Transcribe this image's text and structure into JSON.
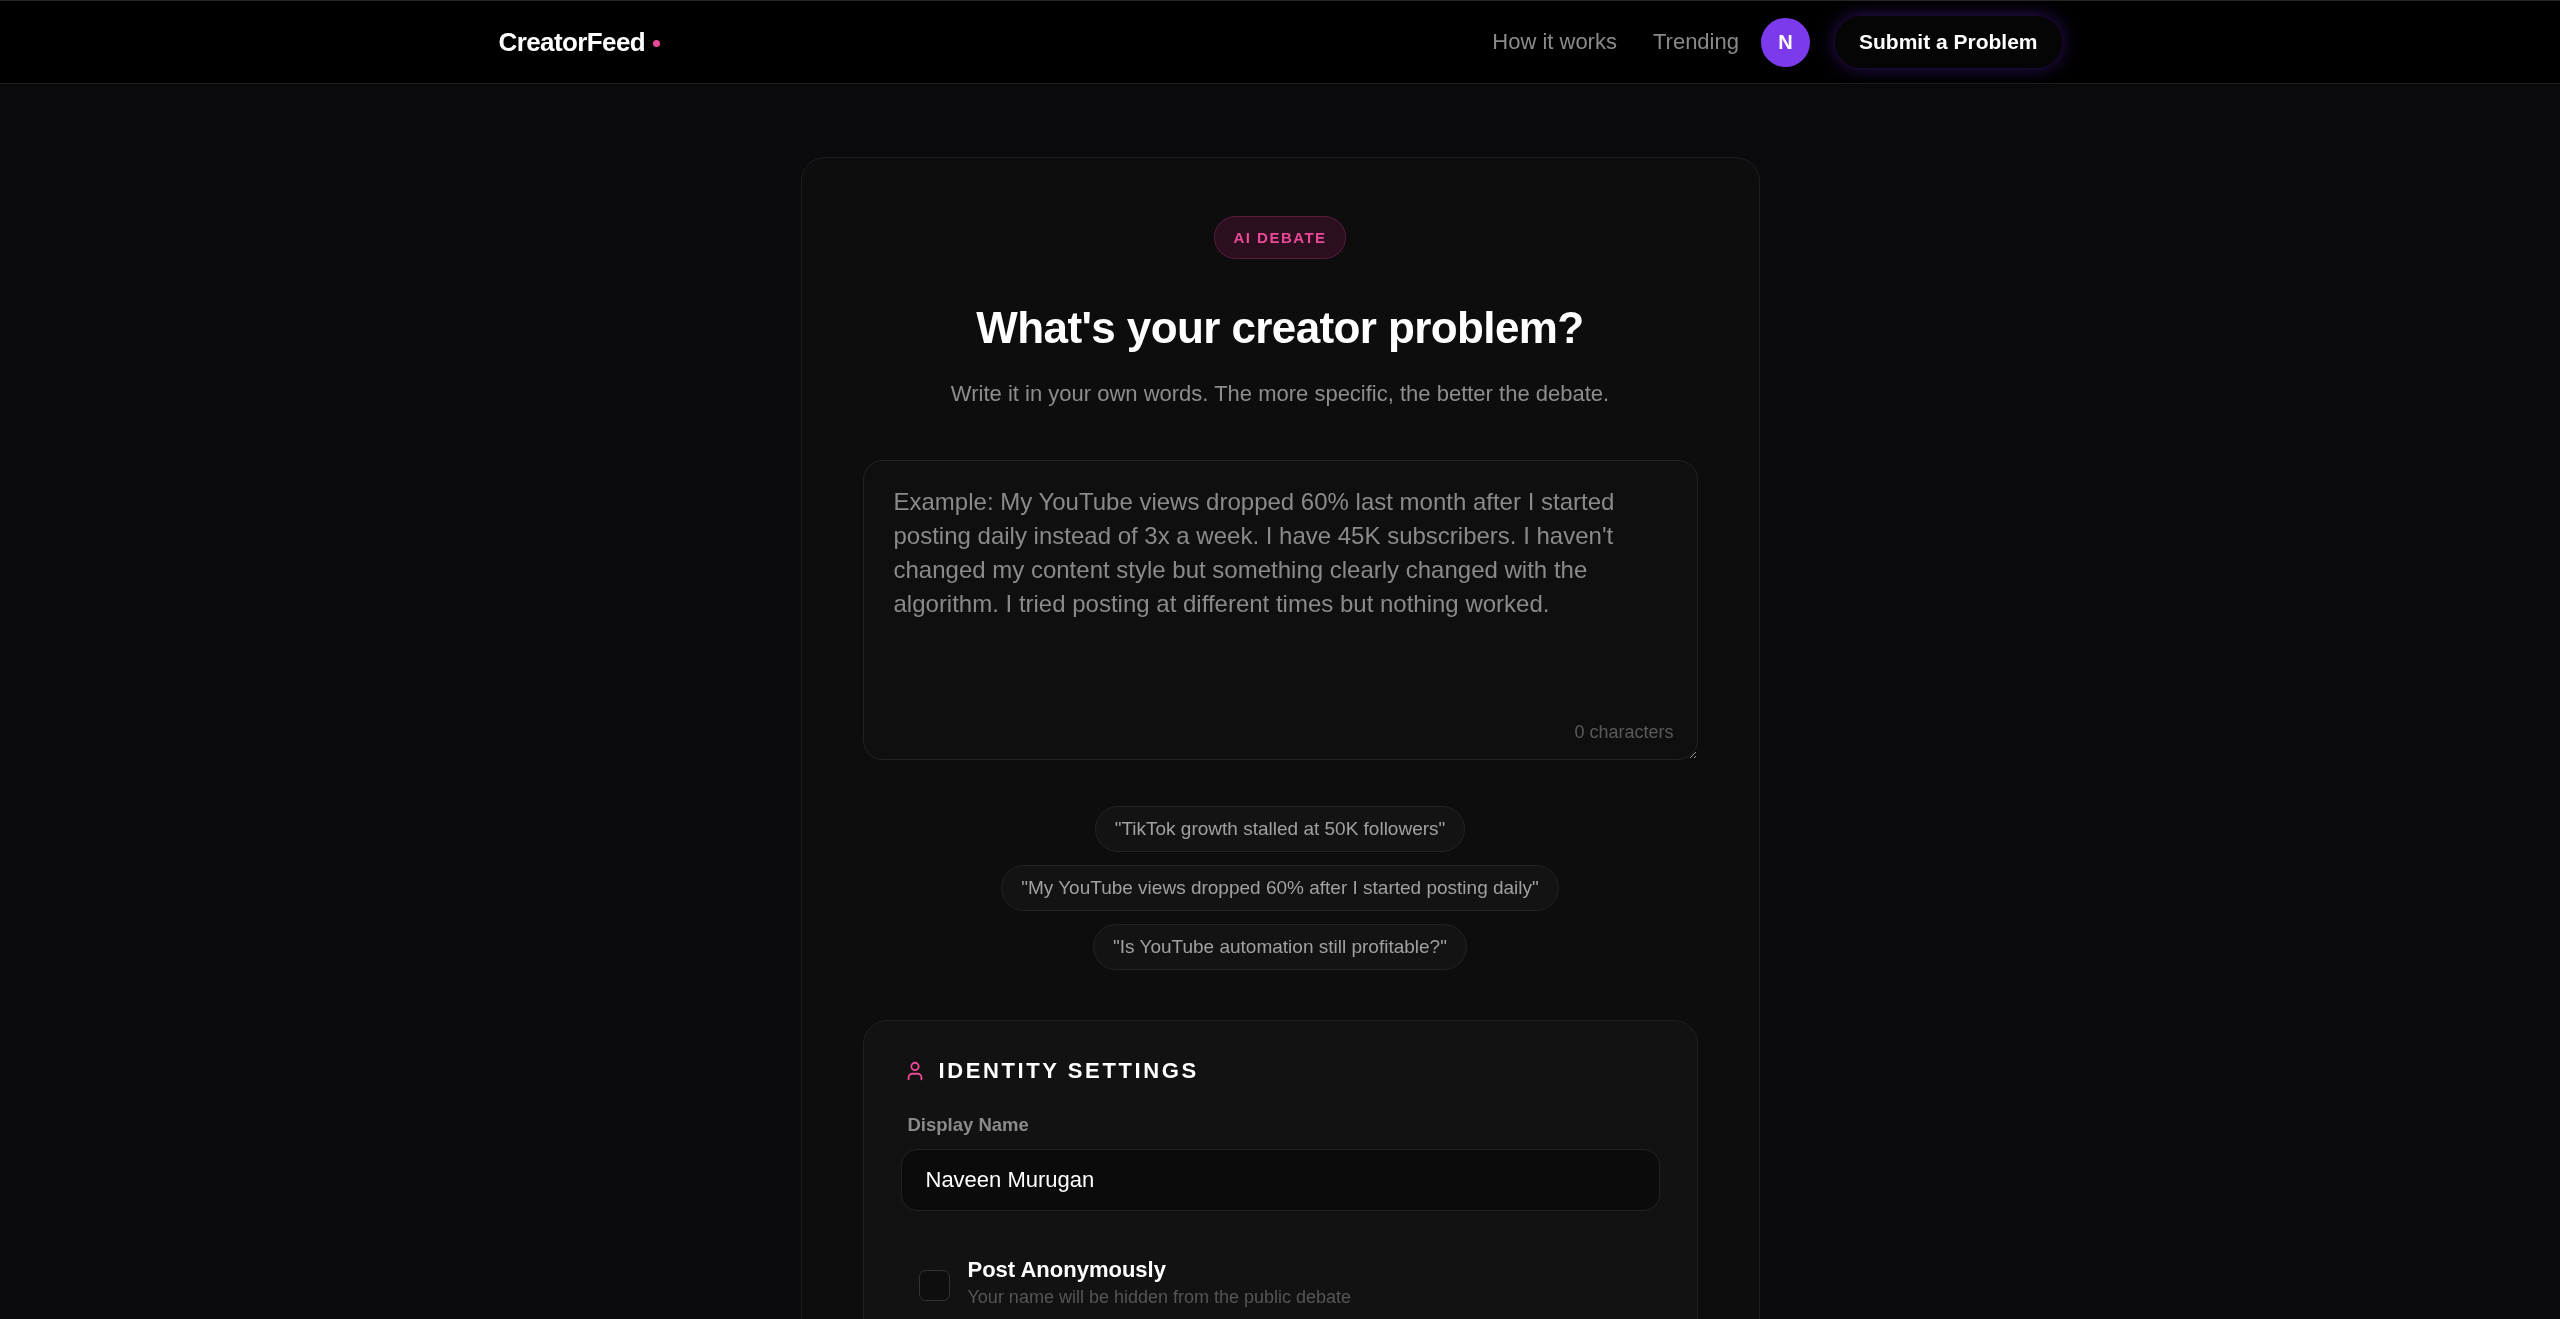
{
  "header": {
    "logo": "CreatorFeed",
    "nav": [
      "How it works",
      "Trending"
    ],
    "avatar_initial": "N",
    "cta": "Submit a Problem"
  },
  "card": {
    "badge": "AI DEBATE",
    "title": "What's your creator problem?",
    "subtitle": "Write it in your own words. The more specific, the better the debate.",
    "problem_field": {
      "placeholder": "Example: My YouTube views dropped 60% last month after I started posting daily instead of 3x a week. I have 45K subscribers. I haven't changed my content style but something clearly changed with the algorithm. I tried posting at different times but nothing worked.",
      "counter": "0 characters"
    },
    "suggestions": [
      "\"TikTok growth stalled at 50K followers\"",
      "\"My YouTube views dropped 60% after I started posting daily\"",
      "\"Is YouTube automation still profitable?\""
    ],
    "identity": {
      "heading": "IDENTITY SETTINGS",
      "display_name": {
        "label": "Display Name",
        "value": "Naveen Murugan"
      },
      "anonymous": {
        "label": "Post Anonymously",
        "description": "Your name will be hidden from the public debate",
        "checked": false
      }
    }
  }
}
